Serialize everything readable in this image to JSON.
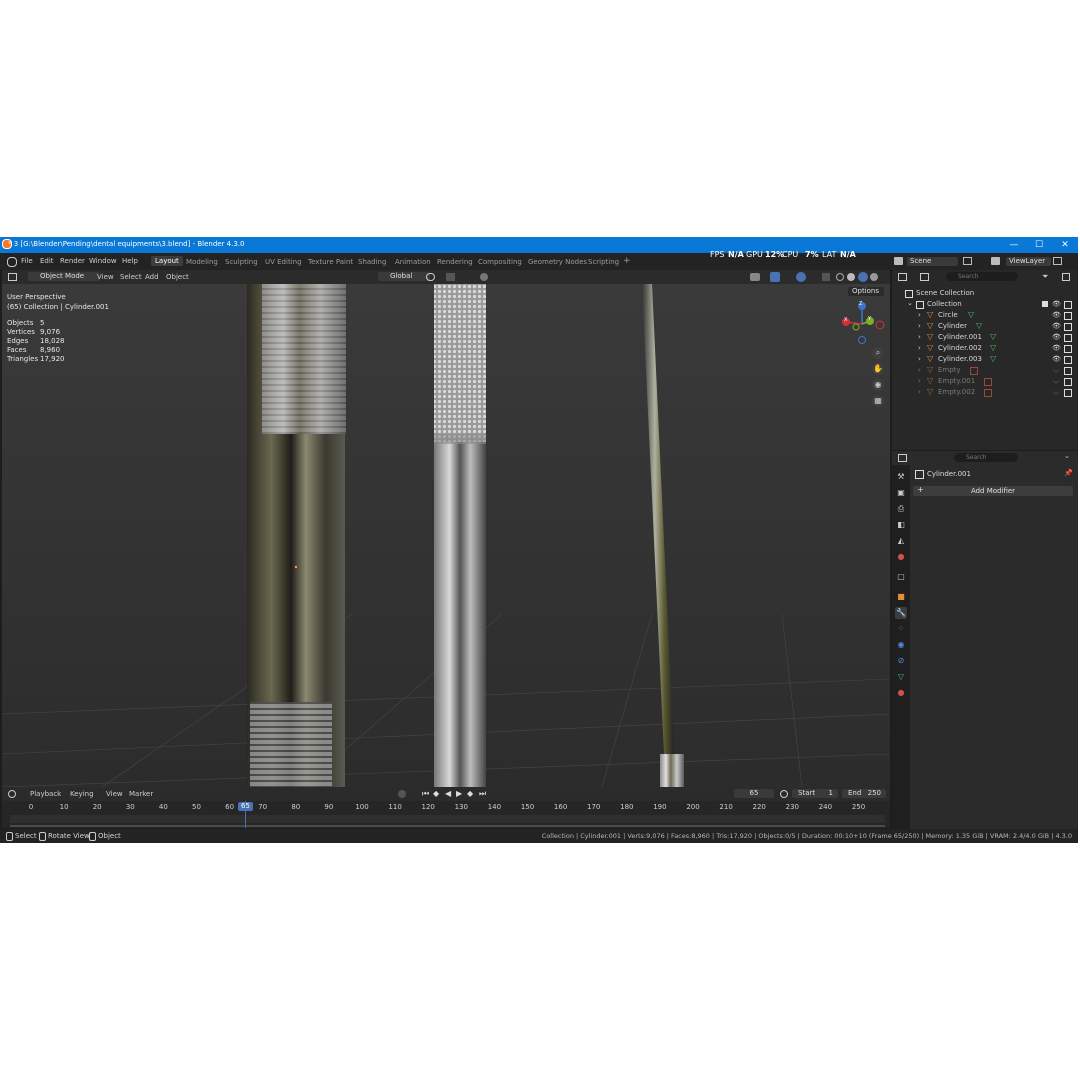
{
  "window": {
    "title": "* 3 [G:\\Blender\\Pending\\dental equipments\\3.blend] - Blender 4.3.0",
    "minimize": "—",
    "maximize": "☐",
    "close": "✕"
  },
  "menu": [
    "File",
    "Edit",
    "Render",
    "Window",
    "Help"
  ],
  "workspaces": [
    "Layout",
    "Modeling",
    "Sculpting",
    "UV Editing",
    "Texture Paint",
    "Shading",
    "Animation",
    "Rendering",
    "Compositing",
    "Geometry Nodes",
    "Scripting"
  ],
  "workspace_add": "+",
  "perf": {
    "fps_label": "FPS",
    "fps": "N/A",
    "gpu_label": "GPU",
    "gpu": "12%",
    "cpu_label": "CPU",
    "cpu": "7%",
    "lat_label": "LAT",
    "lat": "N/A"
  },
  "scene": {
    "label": "Scene",
    "viewlayer": "ViewLayer"
  },
  "header3d": {
    "mode": "Object Mode",
    "view": "View",
    "select": "Select",
    "add": "Add",
    "object": "Object",
    "transform": "Global",
    "options": "Options"
  },
  "viewport": {
    "perspective": "User Perspective",
    "collection_info": "(65) Collection | Cylinder.001",
    "stats": [
      {
        "label": "Objects",
        "value": "5"
      },
      {
        "label": "Vertices",
        "value": "9,076"
      },
      {
        "label": "Edges",
        "value": "18,028"
      },
      {
        "label": "Faces",
        "value": "8,960"
      },
      {
        "label": "Triangles",
        "value": "17,920"
      }
    ],
    "gizmo": {
      "z": "Z",
      "y": "Y",
      "x": "X"
    }
  },
  "outliner": {
    "search_placeholder": "Search",
    "scene_collection": "Scene Collection",
    "collection": "Collection",
    "items": [
      "Circle",
      "Cylinder",
      "Cylinder.001",
      "Cylinder.002",
      "Cylinder.003",
      "Empty",
      "Empty.001",
      "Empty.002"
    ]
  },
  "properties": {
    "search_placeholder": "Search",
    "object_name": "Cylinder.001",
    "add_modifier": "Add Modifier"
  },
  "timeline": {
    "playback": "Playback",
    "keying": "Keying",
    "view": "View",
    "marker": "Marker",
    "current_frame": "65",
    "start_label": "Start",
    "start": "1",
    "end_label": "End",
    "end": "250",
    "ticks": [
      "0",
      "10",
      "20",
      "30",
      "40",
      "50",
      "60",
      "70",
      "80",
      "90",
      "100",
      "110",
      "120",
      "130",
      "140",
      "150",
      "160",
      "170",
      "180",
      "190",
      "200",
      "210",
      "220",
      "230",
      "240",
      "250"
    ]
  },
  "statusbar": {
    "select": "Select",
    "rotate": "Rotate View",
    "object": "Object",
    "info": "Collection | Cylinder.001 | Verts:9,076 | Faces:8,960 | Tris:17,920 | Objects:0/5 | Duration: 00:10+10 (Frame 65/250) | Memory: 1.35 GiB | VRAM: 2.4/4.0 GiB | 4.3.0"
  },
  "colors": {
    "titlebar": "#0a78d7",
    "active_frame": "#4772b3",
    "mesh_icon": "#e78e3b",
    "data_icon": "#45c065"
  }
}
